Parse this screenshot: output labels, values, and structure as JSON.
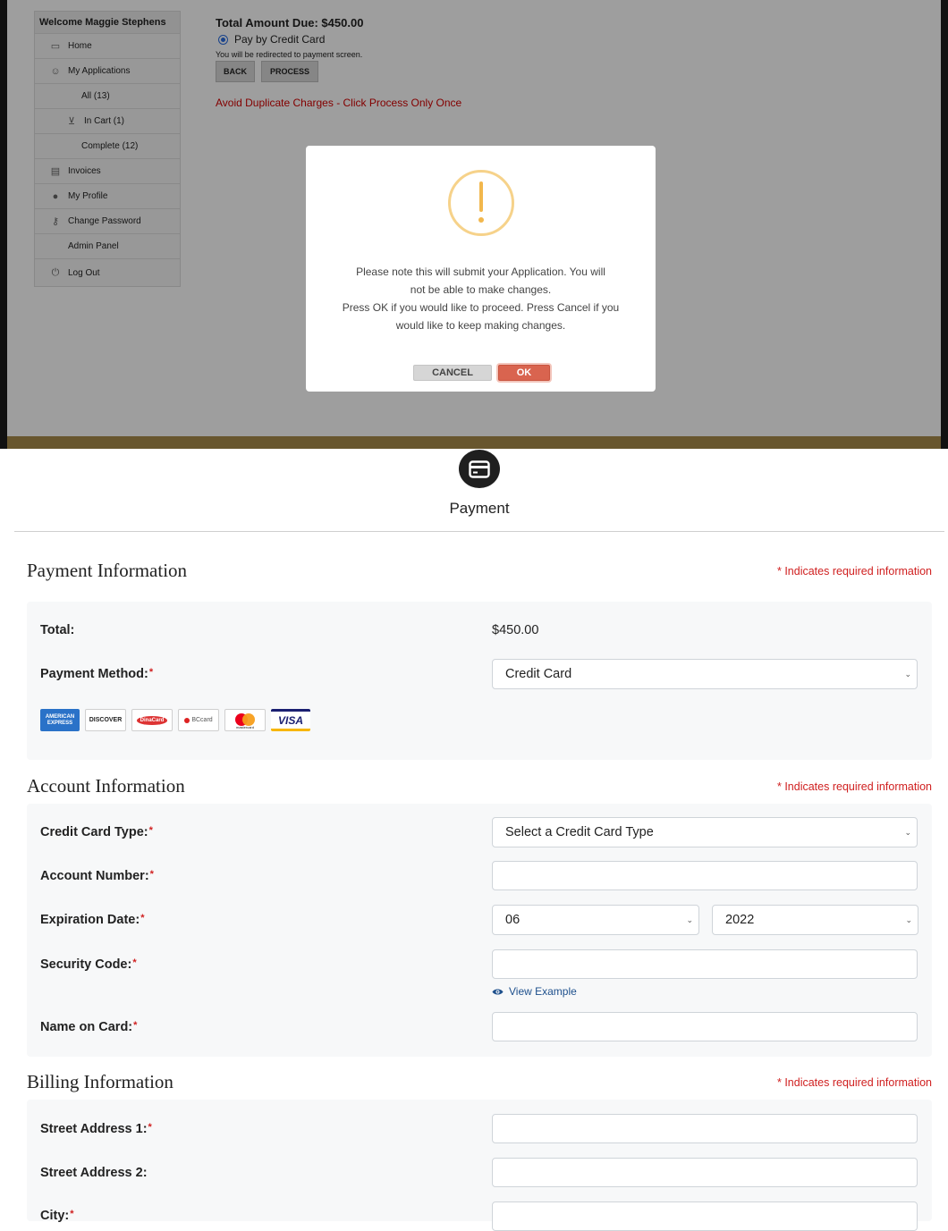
{
  "sidebar": {
    "welcome": "Welcome Maggie Stephens",
    "items": [
      {
        "label": "Home",
        "icon": "home-icon"
      },
      {
        "label": "My Applications",
        "icon": "applications-icon"
      },
      {
        "label": "All (13)"
      },
      {
        "label": "In Cart (1)",
        "icon": "cart-icon"
      },
      {
        "label": "Complete (12)"
      },
      {
        "label": "Invoices",
        "icon": "invoice-icon"
      },
      {
        "label": "My Profile",
        "icon": "profile-icon"
      },
      {
        "label": "Change Password",
        "icon": "key-icon"
      },
      {
        "label": "Admin Panel"
      },
      {
        "label": "Log Out",
        "icon": "power-icon"
      }
    ]
  },
  "checkout": {
    "total_due": "Total Amount Due: $450.00",
    "pay_option": "Pay by Credit Card",
    "redirect_note": "You will be redirected to payment screen.",
    "back_label": "BACK",
    "process_label": "PROCESS",
    "warning": "Avoid Duplicate Charges - Click Process Only Once"
  },
  "modal": {
    "line1": "Please note this will submit your Application. You will",
    "line2": "not be able to make changes.",
    "line3": "Press OK if you would like to proceed. Press Cancel if you",
    "line4": "would like to keep making changes.",
    "cancel_label": "CANCEL",
    "ok_label": "OK",
    "icon": "warning-icon"
  },
  "payment": {
    "header_title": "Payment",
    "required_note": "* Indicates required information",
    "payment_info": {
      "title": "Payment Information",
      "total_label": "Total:",
      "total_value": "$450.00",
      "method_label": "Payment Method:",
      "method_value": "Credit Card",
      "card_logos": [
        "AMERICAN EXPRESS",
        "DISCOVER",
        "DinaCard",
        "BCcard",
        "mastercard",
        "VISA"
      ]
    },
    "account_info": {
      "title": "Account Information",
      "card_type_label": "Credit Card Type:",
      "card_type_value": "Select a Credit Card Type",
      "account_number_label": "Account Number:",
      "expiration_label": "Expiration Date:",
      "exp_month": "06",
      "exp_year": "2022",
      "security_code_label": "Security Code:",
      "view_example": "View Example",
      "name_on_card_label": "Name on Card:"
    },
    "billing_info": {
      "title": "Billing Information",
      "street1_label": "Street Address 1:",
      "street2_label": "Street Address 2:",
      "city_label": "City:"
    }
  },
  "colors": {
    "required_red": "#d02020",
    "link_blue": "#1d4f8c",
    "ok_button": "#d9644f",
    "warning_orange": "#f2b74d",
    "footer_gold": "#a88b4b"
  }
}
